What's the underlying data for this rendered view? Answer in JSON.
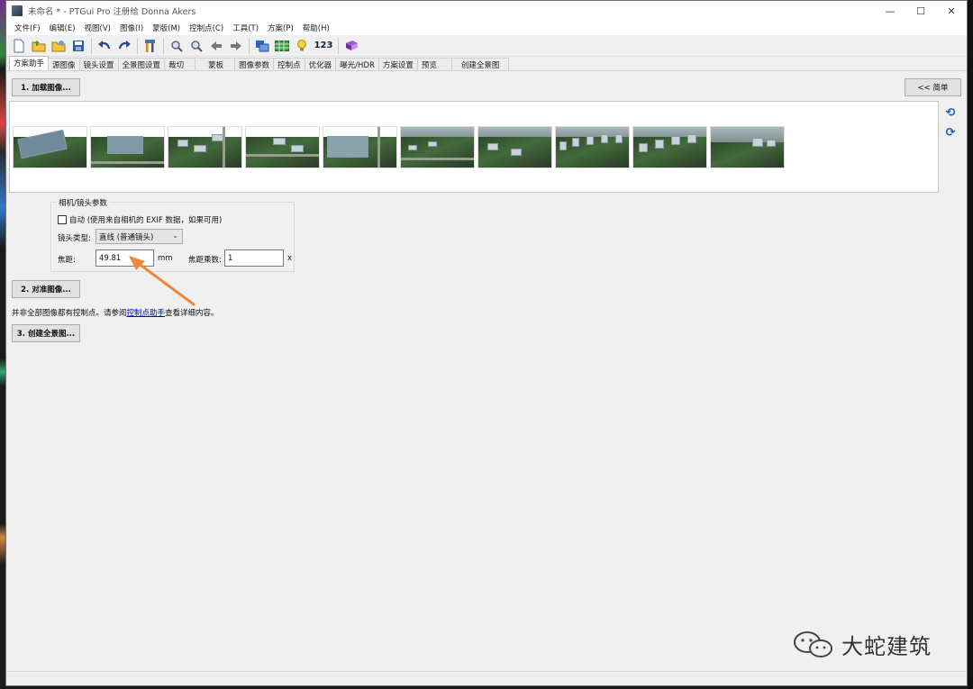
{
  "window": {
    "title": "未命名 * - PTGui Pro 注册给 Donna Akers",
    "controls": [
      "—",
      "☐",
      "✕"
    ]
  },
  "menu": [
    "文件(F)",
    "编辑(E)",
    "视图(V)",
    "图像(I)",
    "蒙版(M)",
    "控制点(C)",
    "工具(T)",
    "方案(P)",
    "帮助(H)"
  ],
  "toolbar": {
    "icons": [
      "new-file-icon",
      "open-folder-icon",
      "open-recent-icon",
      "save-icon",
      "undo-icon",
      "redo-icon",
      "tools-icon",
      "zoom-in-icon",
      "zoom-out-icon",
      "arrow-left-icon",
      "arrow-right-icon",
      "panorama-editor-icon",
      "table-icon",
      "lightbulb-icon",
      "numbers-icon",
      "book-icon"
    ],
    "numbers_label": "123"
  },
  "tabs": [
    "方案助手",
    "源图像",
    "镜头设置",
    "全景图设置",
    "裁切",
    "蒙板",
    "图像参数",
    "控制点",
    "优化器",
    "曝光/HDR",
    "方案设置",
    "预览",
    "创建全景图"
  ],
  "active_tab": 0,
  "buttons": {
    "load_images": "1. 加载图像...",
    "simple": "<< 简单",
    "align_images": "2. 对准图像...",
    "create_panorama": "3. 创建全景图..."
  },
  "thumbnails": [
    "image-1",
    "image-2",
    "image-3",
    "image-4",
    "image-5",
    "image-6",
    "image-7",
    "image-8",
    "image-9",
    "image-10"
  ],
  "camera": {
    "group_title": "相机/镜头参数",
    "auto_label": "自动 (使用来自相机的 EXIF 数据，如果可用)",
    "auto_checked": false,
    "lens_type_label": "镜头类型:",
    "lens_type_value": "直线 (普通镜头)",
    "focal_length_label": "焦距:",
    "focal_length_value": "49.81",
    "focal_unit": "mm",
    "multiplier_label": "焦距乘数:",
    "multiplier_value": "1",
    "multiplier_unit": "x"
  },
  "status": {
    "prefix": "并非全部图像都有控制点。请参阅",
    "link": "控制点助手",
    "suffix": "查看详细内容。"
  },
  "watermark": {
    "text": "大蛇建筑"
  },
  "colors": {
    "accent_blue": "#1f5fb5",
    "arrow_orange": "#f0873a",
    "link": "#0000ee"
  }
}
